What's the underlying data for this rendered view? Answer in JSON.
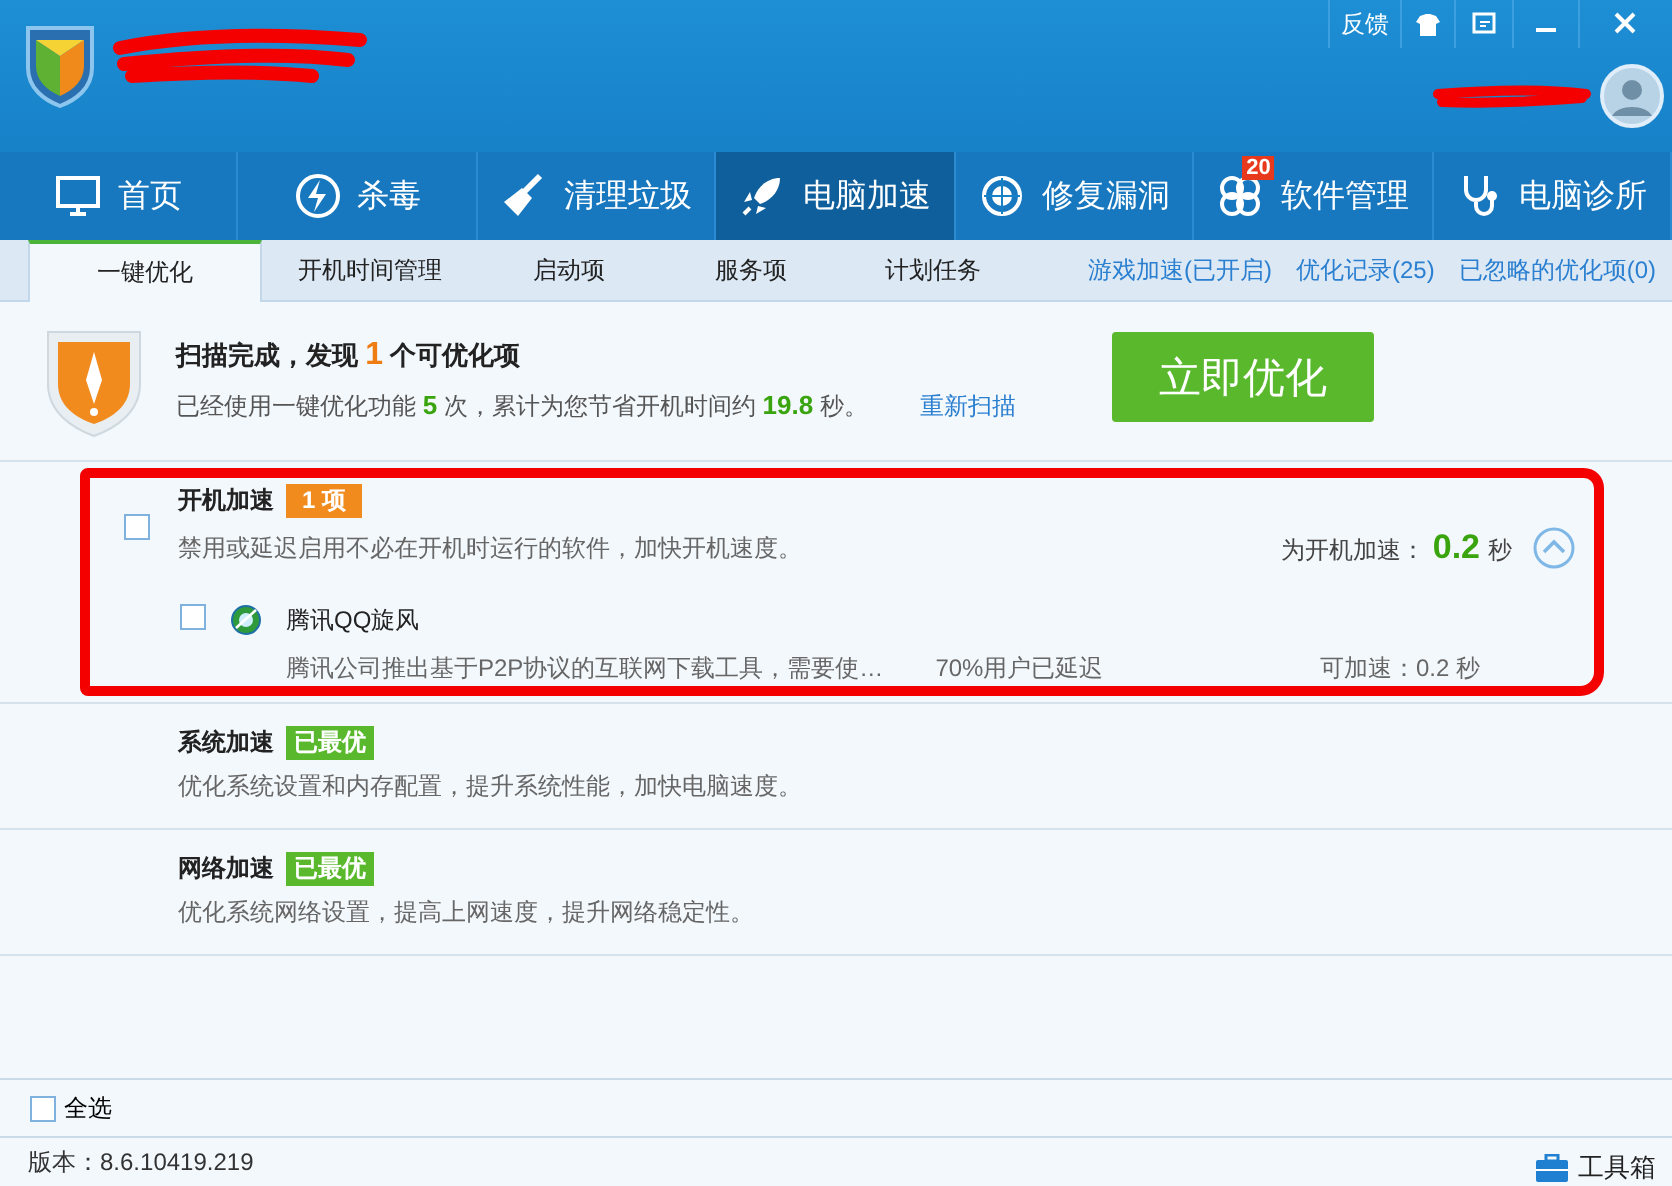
{
  "window": {
    "controls": [
      {
        "kind": "feedback",
        "label": "反馈"
      },
      {
        "kind": "shirt"
      },
      {
        "kind": "mini"
      },
      {
        "kind": "minimize"
      },
      {
        "kind": "close"
      }
    ]
  },
  "nav": [
    {
      "label": "首页",
      "selected": false
    },
    {
      "label": "杀毒",
      "selected": false
    },
    {
      "label": "清理垃圾",
      "selected": false
    },
    {
      "label": "电脑加速",
      "selected": true
    },
    {
      "label": "修复漏洞",
      "selected": false
    },
    {
      "label": "软件管理",
      "badge": "20",
      "selected": false
    },
    {
      "label": "电脑诊所",
      "selected": false
    }
  ],
  "subtabs": [
    {
      "label": "一键优化",
      "selected": true
    },
    {
      "label": "开机时间管理",
      "selected": false
    },
    {
      "label": "启动项",
      "selected": false
    },
    {
      "label": "服务项",
      "selected": false
    },
    {
      "label": "计划任务",
      "selected": false
    }
  ],
  "links": [
    "游戏加速(已开启)",
    "优化记录(25)",
    "已忽略的优化项(0)"
  ],
  "scan": {
    "title_prefix": "扫描完成，发现",
    "count": "1",
    "title_suffix": "个可优化项",
    "summary_prefix": "已经使用一键优化功能",
    "uses": "5",
    "summary_middle": "次，累计为您节省开机时间约",
    "saved": "19.8",
    "summary_suffix": "秒。",
    "rescan": "重新扫描",
    "button": "立即优化"
  },
  "groups": [
    {
      "kind": "pending",
      "title": "开机加速",
      "badge": "1 项",
      "checked": false,
      "description": "禁用或延迟启用不必在开机时运行的软件，加快开机速度。",
      "gain_label": "为开机加速：",
      "gain": "0.2",
      "gain_unit": "秒",
      "expanded": true,
      "items": [
        {
          "name": "腾讯QQ旋风",
          "checked": false,
          "description": "腾讯公司推出基于P2P协议的互联网下载工具，需要使…",
          "stat": "70%用户已延迟",
          "gain": "可加速：0.2 秒"
        }
      ]
    },
    {
      "kind": "optimal",
      "title": "系统加速",
      "badge": "已最优",
      "description": "优化系统设置和内存配置，提升系统性能，加快电脑速度。"
    },
    {
      "kind": "optimal",
      "title": "网络加速",
      "badge": "已最优",
      "description": "优化系统网络设置，提高上网速度，提升网络稳定性。"
    }
  ],
  "select_all": {
    "label": "全选",
    "checked": false
  },
  "footer": {
    "version": "版本：8.6.10419.219",
    "toolbox": "工具箱"
  }
}
